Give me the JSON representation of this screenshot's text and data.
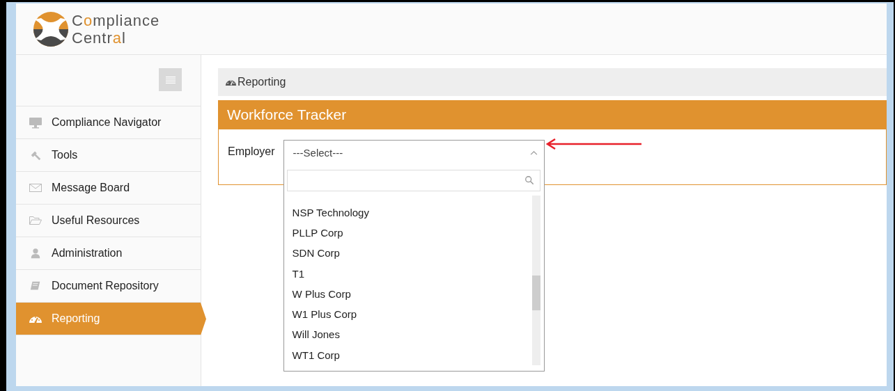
{
  "brand": {
    "lines": [
      [
        {
          "text": "C",
          "accent": false
        },
        {
          "text": "o",
          "accent": true
        },
        {
          "text": "mpliance",
          "accent": false
        }
      ],
      [
        {
          "text": "Centr",
          "accent": false
        },
        {
          "text": "a",
          "accent": true
        },
        {
          "text": "l",
          "accent": false
        }
      ]
    ]
  },
  "sidebar": {
    "items": [
      {
        "label": "Compliance Navigator",
        "selected": false
      },
      {
        "label": "Tools",
        "selected": false
      },
      {
        "label": "Message Board",
        "selected": false
      },
      {
        "label": "Useful Resources",
        "selected": false
      },
      {
        "label": "Administration",
        "selected": false
      },
      {
        "label": "Document Repository",
        "selected": false
      },
      {
        "label": "Reporting",
        "selected": true
      }
    ]
  },
  "breadcrumb": "Reporting",
  "panel": {
    "title": "Workforce Tracker",
    "field_label": "Employer",
    "select": {
      "value": "---Select---",
      "expanded": true,
      "options": [
        "NSP Technology",
        "PLLP Corp",
        "SDN Corp",
        "T1",
        "W Plus Corp",
        "W1 Plus Corp",
        "Will Jones",
        "WT1 Corp"
      ]
    }
  }
}
